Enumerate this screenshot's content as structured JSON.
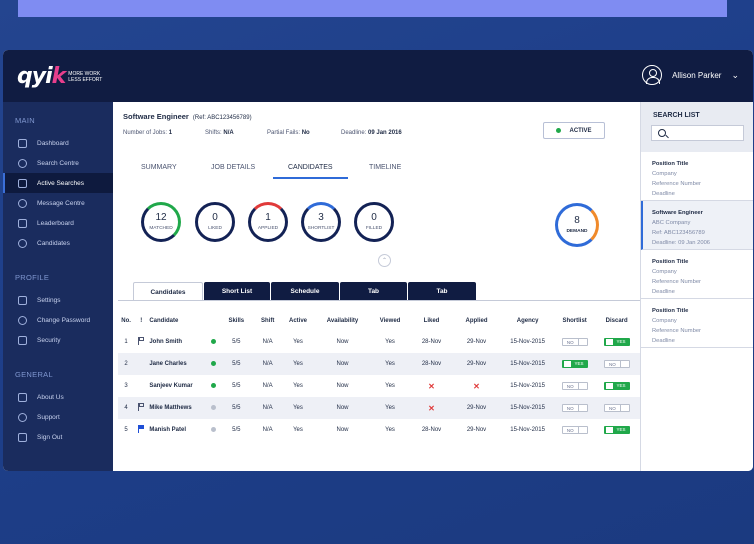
{
  "brand": {
    "logo": "qyik",
    "tagline_1": "MORE WORK",
    "tagline_2": "LESS EFFORT"
  },
  "user": {
    "name": "Allison Parker"
  },
  "sidebar": {
    "main_title": "MAIN",
    "main_items": [
      {
        "label": "Dashboard",
        "icon": "dashboard-icon"
      },
      {
        "label": "Search Centre",
        "icon": "search-icon"
      },
      {
        "label": "Active Searches",
        "icon": "active-searches-icon",
        "active": true
      },
      {
        "label": "Message Centre",
        "icon": "message-icon"
      },
      {
        "label": "Leaderboard",
        "icon": "leaderboard-icon"
      },
      {
        "label": "Candidates",
        "icon": "candidates-icon"
      }
    ],
    "profile_title": "PROFILE",
    "profile_items": [
      {
        "label": "Settings",
        "icon": "gear-icon"
      },
      {
        "label": "Change Password",
        "icon": "key-icon"
      },
      {
        "label": "Security",
        "icon": "shield-icon"
      }
    ],
    "general_title": "GENERAL",
    "general_items": [
      {
        "label": "About Us",
        "icon": "info-icon"
      },
      {
        "label": "Support",
        "icon": "support-icon"
      },
      {
        "label": "Sign Out",
        "icon": "sign-out-icon"
      }
    ]
  },
  "job": {
    "title": "Software Engineer",
    "ref": "(Ref: ABC123456789)",
    "jobs_label": "Number of Jobs:",
    "jobs_value": "1",
    "shifts_label": "Shifts:",
    "shifts_value": "N/A",
    "partial_label": "Partial Fails:",
    "partial_value": "No",
    "deadline_label": "Deadline:",
    "deadline_value": "09 Jan 2016",
    "status": "ACTIVE",
    "status_color": "#20a84a"
  },
  "tabs": [
    "SUMMARY",
    "JOB DETAILS",
    "CANDIDATES",
    "TIMELINE"
  ],
  "selected_tab": "CANDIDATES",
  "stats": [
    {
      "value": "12",
      "label": "MATCHED"
    },
    {
      "value": "0",
      "label": "LIKED"
    },
    {
      "value": "1",
      "label": "APPLIED"
    },
    {
      "value": "3",
      "label": "SHORTLIST"
    },
    {
      "value": "0",
      "label": "FILLED"
    }
  ],
  "demand": {
    "value": "8",
    "label": "DEMAND"
  },
  "subtabs": [
    "Candidates",
    "Short List",
    "Schedule",
    "Tab",
    "Tab"
  ],
  "table": {
    "headers": [
      "No.",
      "!",
      "Candidate",
      "",
      "Skills",
      "Shift",
      "Active",
      "Availability",
      "Viewed",
      "Liked",
      "Applied",
      "Agency",
      "Shortlist",
      "Discard"
    ],
    "rows": [
      {
        "no": "1",
        "flag": "outline",
        "name": "John Smith",
        "dot": "green",
        "skills": "5/5",
        "shift": "N/A",
        "active": "Yes",
        "availability": "Now",
        "viewed": "Yes",
        "liked": "28-Nov",
        "applied": "29-Nov",
        "agency": "15-Nov-2015",
        "shortlist": "NO",
        "discard": "YES"
      },
      {
        "no": "2",
        "flag": "",
        "name": "Jane Charles",
        "dot": "green",
        "skills": "5/5",
        "shift": "N/A",
        "active": "Yes",
        "availability": "Now",
        "viewed": "Yes",
        "liked": "28-Nov",
        "applied": "29-Nov",
        "agency": "15-Nov-2015",
        "shortlist": "YES",
        "discard": "NO"
      },
      {
        "no": "3",
        "flag": "",
        "name": "Sanjeev Kumar",
        "dot": "green",
        "skills": "5/5",
        "shift": "N/A",
        "active": "Yes",
        "availability": "Now",
        "viewed": "Yes",
        "liked": "✕",
        "applied": "✕",
        "agency": "15-Nov-2015",
        "shortlist": "NO",
        "discard": "YES"
      },
      {
        "no": "4",
        "flag": "outline",
        "name": "Mike Matthews",
        "dot": "gray",
        "skills": "5/5",
        "shift": "N/A",
        "active": "Yes",
        "availability": "Now",
        "viewed": "Yes",
        "liked": "✕",
        "applied": "29-Nov",
        "agency": "15-Nov-2015",
        "shortlist": "NO",
        "discard": "NO"
      },
      {
        "no": "5",
        "flag": "blue",
        "name": "Manish Patel",
        "dot": "gray",
        "skills": "5/5",
        "shift": "N/A",
        "active": "Yes",
        "availability": "Now",
        "viewed": "Yes",
        "liked": "28-Nov",
        "applied": "29-Nov",
        "agency": "15-Nov-2015",
        "shortlist": "NO",
        "discard": "YES"
      }
    ]
  },
  "search_list": {
    "title": "SEARCH LIST",
    "items": [
      {
        "lines": [
          "Position Title",
          "Company",
          "Reference Number",
          "Deadline"
        ]
      },
      {
        "lines": [
          "Software Engineer",
          "ABC Company",
          "Ref: ABC123456789",
          "Deadline: 09 Jan 2006"
        ],
        "selected": true
      },
      {
        "lines": [
          "Position Title",
          "Company",
          "Reference Number",
          "Deadline"
        ]
      },
      {
        "lines": [
          "Position Title",
          "Company",
          "Reference Number",
          "Deadline"
        ]
      }
    ]
  }
}
